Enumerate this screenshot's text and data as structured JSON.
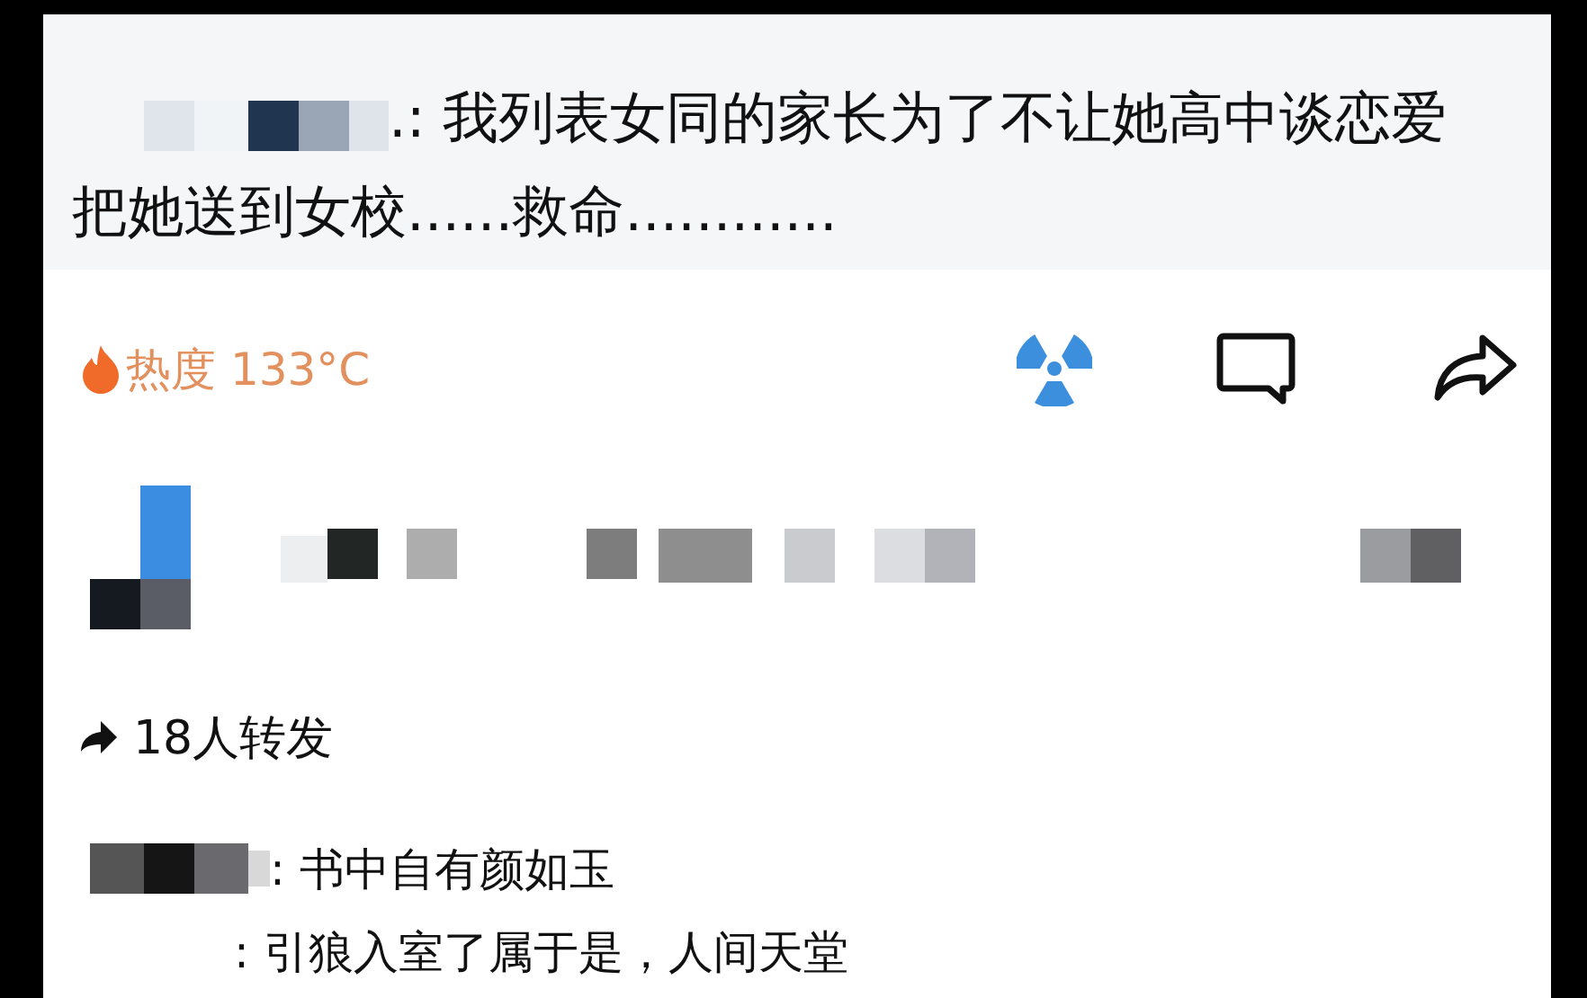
{
  "post": {
    "text": ".: 我列表女同的家长为了不让她高中谈恋爱把她送到女校......救命............"
  },
  "stats": {
    "heat_label": "热度 133°C"
  },
  "reposts": {
    "text": "18人转发"
  },
  "comments": [
    {
      "text": ": 书中自有颜如玉",
      "redacted_name": true
    },
    {
      "text": ": 引狼入室了属于是，人间天堂",
      "redacted_name": false
    }
  ]
}
